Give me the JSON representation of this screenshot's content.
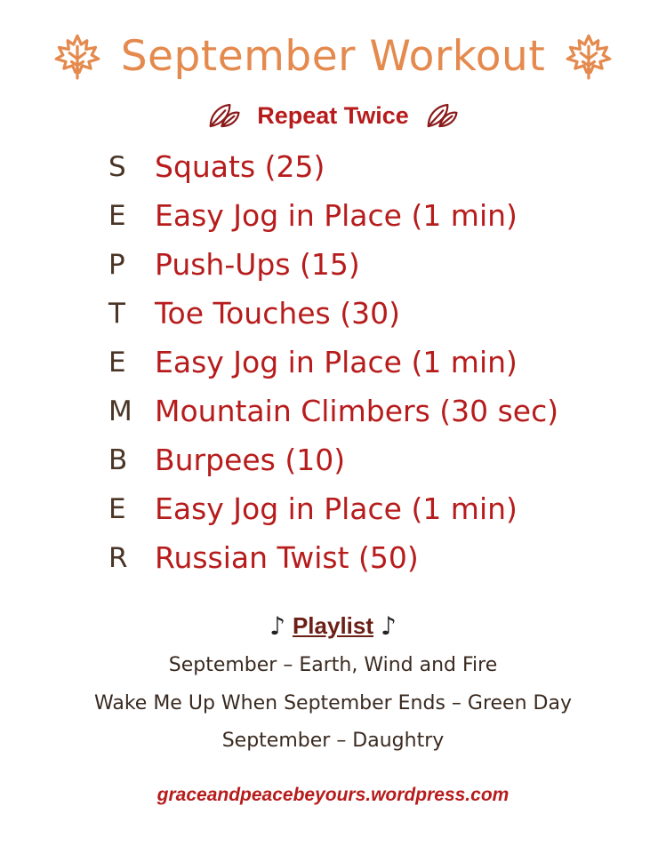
{
  "header": {
    "title": "September Workout",
    "subtitle": "Repeat Twice",
    "title_color": "#E58A4E",
    "accent_color": "#B71C1C",
    "title_icon": "maple-leaf-icon",
    "subtitle_icon": "autumn-leaf-icon"
  },
  "workout": [
    {
      "letter": "S",
      "exercise": "Squats (25)"
    },
    {
      "letter": "E",
      "exercise": "Easy Jog in Place (1 min)"
    },
    {
      "letter": "P",
      "exercise": "Push-Ups (15)"
    },
    {
      "letter": "T",
      "exercise": "Toe Touches (30)"
    },
    {
      "letter": "E",
      "exercise": "Easy Jog in Place (1 min)"
    },
    {
      "letter": "M",
      "exercise": "Mountain Climbers (30 sec)"
    },
    {
      "letter": "B",
      "exercise": "Burpees (10)"
    },
    {
      "letter": "E",
      "exercise": "Easy Jog in Place (1 min)"
    },
    {
      "letter": "R",
      "exercise": "Russian Twist (50)"
    }
  ],
  "playlist": {
    "title": "Playlist",
    "note_symbol": "♪",
    "songs": [
      "September – Earth, Wind and Fire",
      "Wake Me Up When September Ends – Green Day",
      "September – Daughtry"
    ]
  },
  "footer": {
    "url": "graceandpeacebeyours.wordpress.com"
  }
}
